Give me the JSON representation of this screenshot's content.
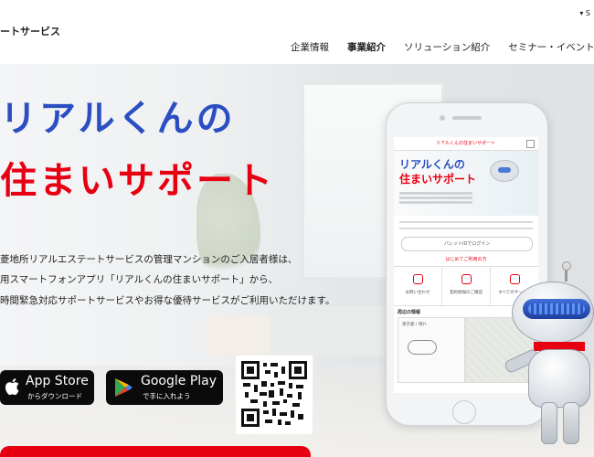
{
  "header": {
    "logo_text": "ートサービス",
    "lang_label": "▾ S",
    "nav": [
      {
        "label": "企業情報",
        "active": false
      },
      {
        "label": "事業紹介",
        "active": true
      },
      {
        "label": "ソリューション紹介",
        "active": false
      },
      {
        "label": "セミナー・イベント",
        "active": false
      }
    ]
  },
  "hero": {
    "title_line1": "リアルくんの",
    "title_line2": "住まいサポート",
    "body_line1": "菱地所リアルエステートサービスの管理マンションのご入居者様は、",
    "body_line2": "用スマートフォンアプリ「リアルくんの住まいサポート」から、",
    "body_line3": "時間緊急対応サポートサービスやお得な優待サービスがご利用いただけます。",
    "appstore": {
      "big": "App Store",
      "small": "からダウンロード"
    },
    "googleplay": {
      "big": "Google Play",
      "small": "で手に入れよう"
    }
  },
  "phone_screen": {
    "top_title": "リアルくんの住まいサポート",
    "hero_line1": "リアルくんの",
    "hero_line2": "住まいサポート",
    "login_label": "パレットIDでログイン",
    "first_time_label": "はじめてご利用の方",
    "tiles": [
      "お問い合わせ",
      "契約情報のご確認",
      "すべてのサービス"
    ],
    "section_title": "周辺の情報",
    "weather_label": "東京都 / 晴れ"
  },
  "colors": {
    "accent_red": "#e60012",
    "accent_blue": "#2b4fc3"
  }
}
